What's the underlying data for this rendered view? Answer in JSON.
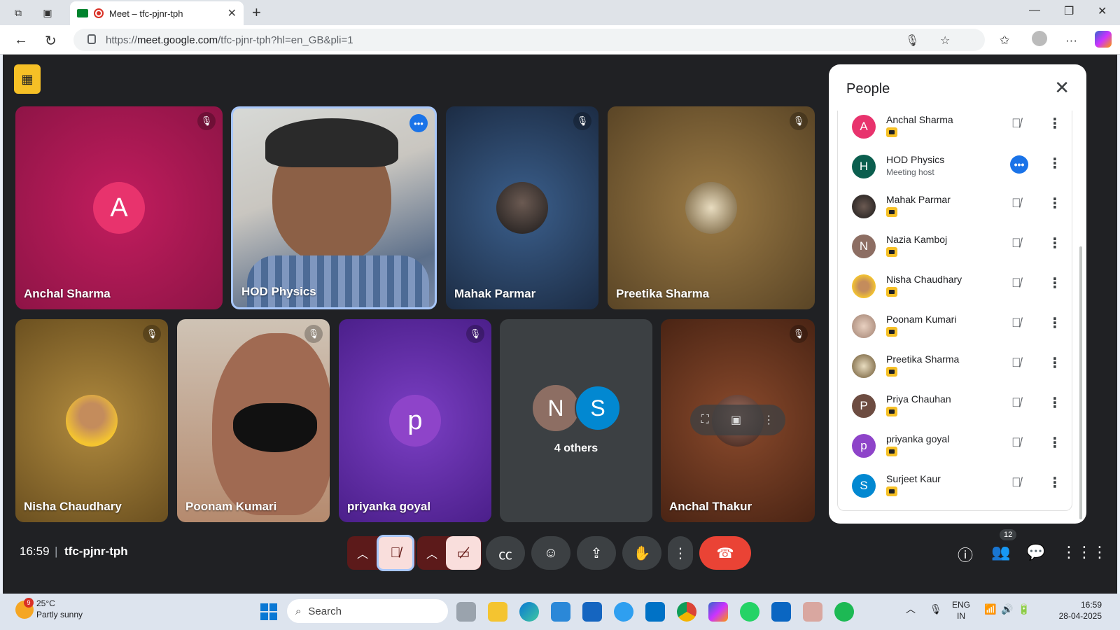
{
  "browser": {
    "tab_title": "Meet – tfc-pjnr-tph",
    "url_prefix": "https://",
    "url_host": "meet.google.com",
    "url_path": "/tfc-pjnr-tph?hl=en_GB&pli=1"
  },
  "tiles": {
    "row1": [
      {
        "name": "Anchal Sharma",
        "initial": "A",
        "bg": "#c2185b"
      },
      {
        "name": "HOD Physics"
      },
      {
        "name": "Mahak Parmar"
      },
      {
        "name": "Preetika Sharma"
      }
    ],
    "row2": [
      {
        "name": "Nisha Chaudhary"
      },
      {
        "name": "Poonam Kumari"
      },
      {
        "name": "priyanka goyal",
        "initial": "p"
      },
      {
        "name": "4 others",
        "initials": [
          "N",
          "S"
        ]
      },
      {
        "name": "Anchal Thakur"
      }
    ]
  },
  "people_panel": {
    "title": "People",
    "participants": [
      {
        "name": "Anchal Sharma",
        "initial": "A",
        "color": "#e8336d"
      },
      {
        "name": "HOD Physics",
        "initial": "H",
        "color": "#0b5e4e",
        "subtitle": "Meeting host"
      },
      {
        "name": "Mahak Parmar",
        "initial": "",
        "color": "#3b3b3b"
      },
      {
        "name": "Nazia Kamboj",
        "initial": "N",
        "color": "#8d6e63"
      },
      {
        "name": "Nisha Chaudhary",
        "initial": "",
        "color": "#c9a24a"
      },
      {
        "name": "Poonam Kumari",
        "initial": "",
        "color": "#b08f80"
      },
      {
        "name": "Preetika Sharma",
        "initial": "",
        "color": "#8c6a3c"
      },
      {
        "name": "Priya Chauhan",
        "initial": "P",
        "color": "#6d4c41"
      },
      {
        "name": "priyanka goyal",
        "initial": "p",
        "color": "#8e44c9"
      },
      {
        "name": "Surjeet Kaur",
        "initial": "S",
        "color": "#0288d1"
      }
    ]
  },
  "controls": {
    "time": "16:59",
    "meeting_code": "tfc-pjnr-tph",
    "people_count": "12"
  },
  "taskbar": {
    "temperature": "25°C",
    "weather": "Partly sunny",
    "weather_badge": "9",
    "search_placeholder": "Search",
    "lang": "ENG",
    "region": "IN",
    "clock_time": "16:59",
    "clock_date": "28-04-2025"
  }
}
